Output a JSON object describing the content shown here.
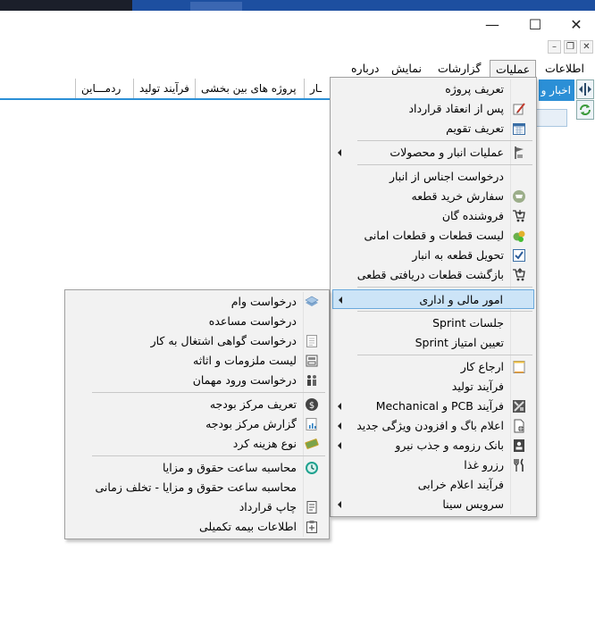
{
  "window": {
    "minimize": "—",
    "maximize": "☐",
    "close": "✕",
    "mdi_min": "–",
    "mdi_restore": "❐",
    "mdi_close": "✕"
  },
  "menubar": [
    "اطلاعات",
    "عملیات",
    "گزارشات",
    "نمایش",
    "درباره"
  ],
  "tabs": [
    "ردمـــاین",
    "فرآیند تولید",
    "پروژه های بین بخشی",
    "ـار"
  ],
  "side_button_label": "اخبار و",
  "main_menu": [
    {
      "label": "تعریف پروژه",
      "icon": "none"
    },
    {
      "label": "پس از انعقاد قرارداد",
      "icon": "contract-pen-icon"
    },
    {
      "label": "تعریف تقویم",
      "icon": "calendar-icon"
    },
    {
      "sep": true
    },
    {
      "label": "عملیات انبار و محصولات",
      "icon": "warehouse-flag-icon",
      "submenu": true
    },
    {
      "sep": true
    },
    {
      "label": "درخواست اجناس از انبار",
      "icon": "none"
    },
    {
      "label": "سفارش خرید قطعه",
      "icon": "buy-cart-green-icon"
    },
    {
      "label": "فروشنده گان",
      "icon": "vendor-cart-icon"
    },
    {
      "label": "لیست قطعات و قطعات امانی",
      "icon": "parts-list-icon"
    },
    {
      "label": "تحویل قطعه به انبار",
      "icon": "checkbox-delivery-icon"
    },
    {
      "label": "بازگشت قطعات دریافتی قطعی",
      "icon": "return-cart-icon"
    },
    {
      "sep": true
    },
    {
      "label": "امور مالی و اداری",
      "icon": "none",
      "submenu": true,
      "highlight": true
    },
    {
      "sep": true
    },
    {
      "label": "جلسات Sprint",
      "icon": "none"
    },
    {
      "label": "تعیین امتیاز Sprint",
      "icon": "none"
    },
    {
      "sep": true
    },
    {
      "label": "ارجاع کار",
      "icon": "assign-note-icon"
    },
    {
      "label": "فرآیند تولید",
      "icon": "none"
    },
    {
      "label": "فرآیند PCB و Mechanical",
      "icon": "pcb-tools-icon",
      "submenu": true
    },
    {
      "label": "اعلام باگ و افزودن ویژگی جدید",
      "icon": "bug-doc-icon",
      "submenu": true
    },
    {
      "label": "بانک رزومه و جذب نیرو",
      "icon": "resume-icon",
      "submenu": true
    },
    {
      "label": "رزرو غذا",
      "icon": "fork-knife-icon"
    },
    {
      "label": "فرآیند اعلام خرابی",
      "icon": "none"
    },
    {
      "label": "سرویس سینا",
      "icon": "none",
      "submenu": true
    }
  ],
  "sub_menu": [
    {
      "label": "درخواست وام",
      "icon": "loan-stack-icon"
    },
    {
      "label": "درخواست مساعده",
      "icon": "none"
    },
    {
      "label": "درخواست گواهی اشتغال به کار",
      "icon": "certificate-doc-icon"
    },
    {
      "label": "لیست ملزومات و اثاثه",
      "icon": "supplies-icon"
    },
    {
      "label": "درخواست ورود مهمان",
      "icon": "guests-icon"
    },
    {
      "sep": true
    },
    {
      "label": "تعریف مرکز بودجه",
      "icon": "dollar-coin-icon"
    },
    {
      "label": "گزارش مرکز بودجه",
      "icon": "report-chart-icon"
    },
    {
      "label": "نوع هزینه کرد",
      "icon": "expense-money-icon"
    },
    {
      "sep": true
    },
    {
      "label": "محاسبه ساعت حقوق و مزایا",
      "icon": "clock-teal-icon"
    },
    {
      "label": "محاسبه ساعت حقوق و مزایا - تخلف زمانی",
      "icon": "none"
    },
    {
      "label": "چاپ قرارداد",
      "icon": "print-doc-icon"
    },
    {
      "label": "اطلاعات بیمه تکمیلی",
      "icon": "insurance-clipboard-icon"
    }
  ]
}
